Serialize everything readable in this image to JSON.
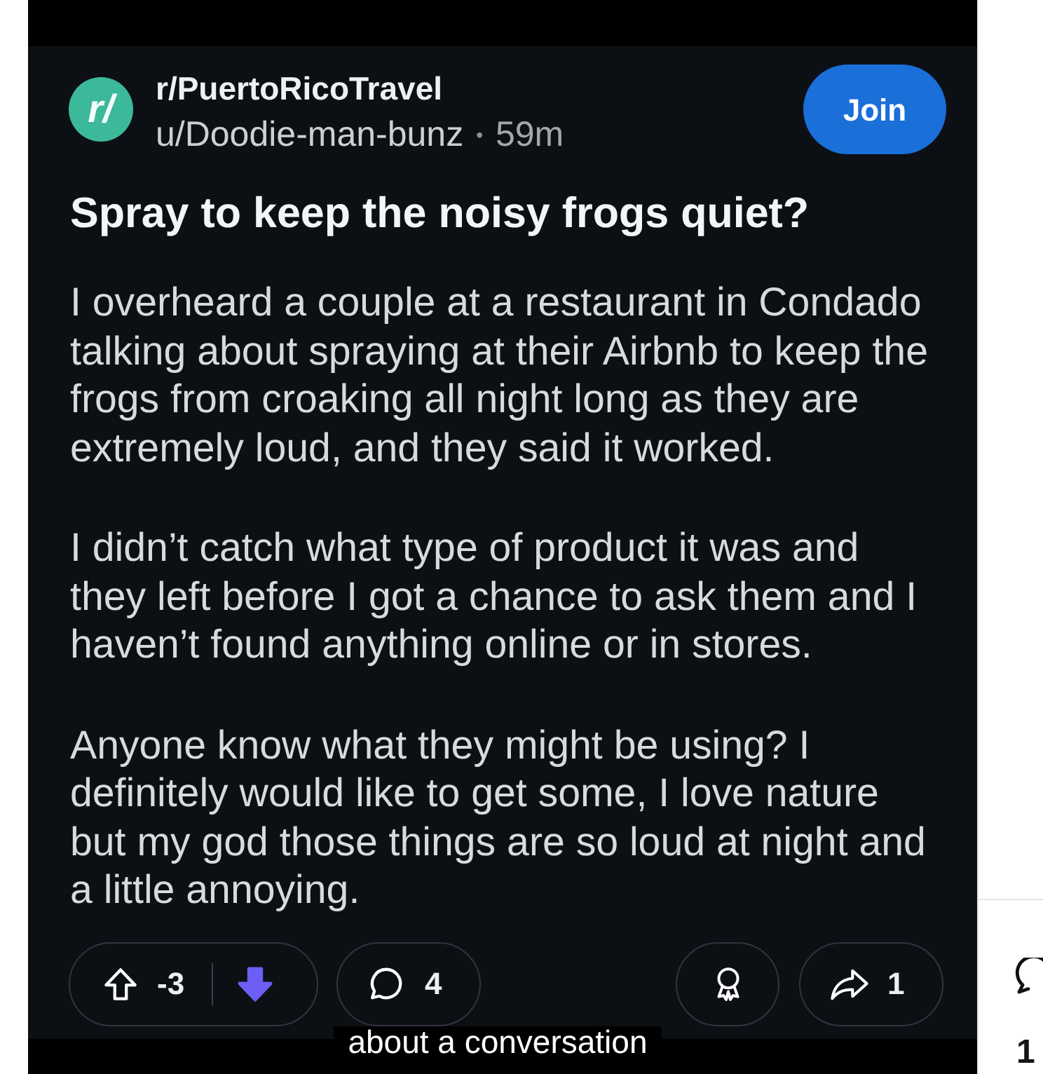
{
  "post": {
    "avatar_label": "r/",
    "subreddit": "r/PuertoRicoTravel",
    "author": "u/Doodie-man-bunz",
    "separator": "•",
    "age": "59m",
    "join_label": "Join",
    "title": "Spray to keep the noisy frogs quiet?",
    "body": [
      "I overheard a couple at a restaurant in Condado talking about spraying at their Airbnb to keep the frogs from croaking all night long as they are extremely loud, and they said it worked.",
      "I didn’t catch what type of product it was and they left before I got a chance to ask them and I haven’t found anything online or in stores.",
      "Anyone know what they might be using? I definitely would like to get some, I love nature but my god those things are so loud at night and a little annoying."
    ],
    "actions": {
      "upvoted": false,
      "score": "-3",
      "downvoted": true,
      "comments": "4",
      "shares": "1"
    }
  },
  "caption": "about a conversation",
  "side_panel": {
    "count": "1"
  }
}
